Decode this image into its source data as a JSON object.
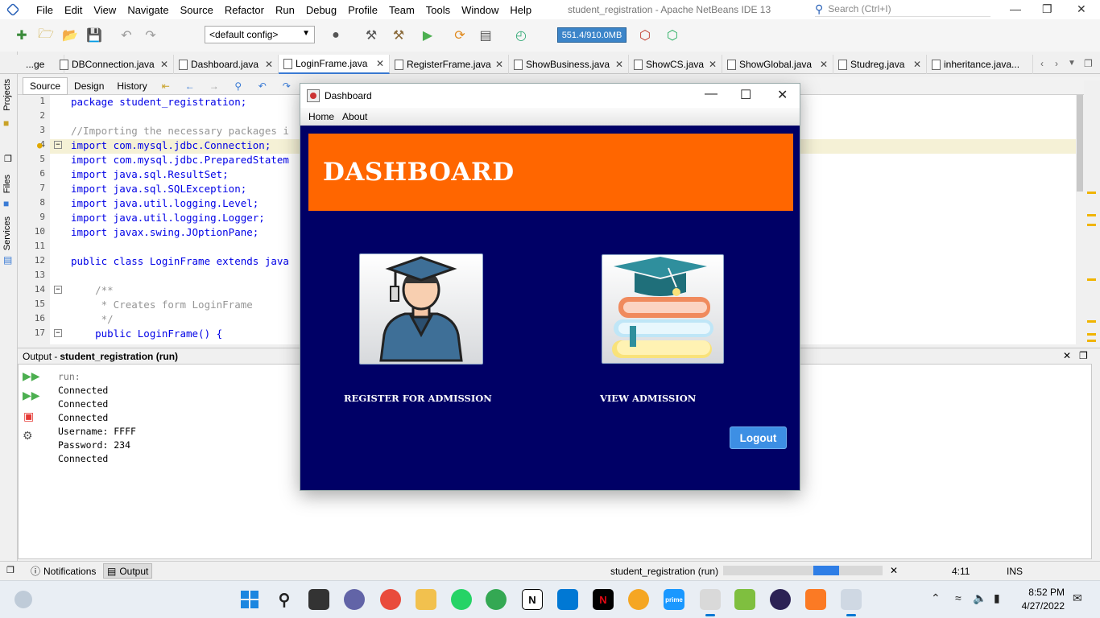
{
  "menubar": {
    "items": [
      "File",
      "Edit",
      "View",
      "Navigate",
      "Source",
      "Refactor",
      "Run",
      "Debug",
      "Profile",
      "Team",
      "Tools",
      "Window",
      "Help"
    ],
    "window_title": "student_registration - Apache NetBeans IDE 13",
    "search_placeholder": "Search (Ctrl+I)"
  },
  "toolbar": {
    "config": "<default config>",
    "memory": "551.4/910.0MB"
  },
  "tabs": [
    {
      "label": "...ge"
    },
    {
      "label": "DBConnection.java"
    },
    {
      "label": "Dashboard.java"
    },
    {
      "label": "LoginFrame.java",
      "active": true
    },
    {
      "label": "RegisterFrame.java"
    },
    {
      "label": "ShowBusiness.java"
    },
    {
      "label": "ShowCS.java"
    },
    {
      "label": "ShowGlobal.java"
    },
    {
      "label": "Studreg.java"
    },
    {
      "label": "inheritance.java..."
    }
  ],
  "sidebar": {
    "projects": "Projects",
    "files": "Files",
    "services": "Services"
  },
  "editor": {
    "views": [
      "Source",
      "Design",
      "History"
    ],
    "lines": [
      {
        "n": "1",
        "text": "package student_registration;"
      },
      {
        "n": "2",
        "text": ""
      },
      {
        "n": "3",
        "text": "//Importing the necessary packages i"
      },
      {
        "n": "4",
        "text": "import com.mysql.jdbc.Connection;"
      },
      {
        "n": "5",
        "text": "import com.mysql.jdbc.PreparedStatem"
      },
      {
        "n": "6",
        "text": "import java.sql.ResultSet;"
      },
      {
        "n": "7",
        "text": "import java.sql.SQLException;"
      },
      {
        "n": "8",
        "text": "import java.util.logging.Level;"
      },
      {
        "n": "9",
        "text": "import java.util.logging.Logger;"
      },
      {
        "n": "10",
        "text": "import javax.swing.JOptionPane;"
      },
      {
        "n": "11",
        "text": ""
      },
      {
        "n": "12",
        "text": "public class LoginFrame extends java"
      },
      {
        "n": "13",
        "text": ""
      },
      {
        "n": "14",
        "text": "    /**"
      },
      {
        "n": "15",
        "text": "     * Creates form LoginFrame"
      },
      {
        "n": "16",
        "text": "     */"
      },
      {
        "n": "17",
        "text": "    public LoginFrame() {"
      }
    ]
  },
  "output": {
    "header_prefix": "Output - ",
    "header_title": "student_registration (run)",
    "lines": [
      "run:",
      "Connected",
      "Connected",
      "Connected",
      "Username: FFFF",
      "Password: 234",
      "Connected"
    ]
  },
  "statusbar": {
    "notifications": "Notifications",
    "output": "Output",
    "task": "student_registration (run)",
    "position": "4:11",
    "mode": "INS"
  },
  "dashboard": {
    "title": "Dashboard",
    "menu": [
      "Home",
      "About"
    ],
    "banner": "DASHBOARD",
    "register_label": "REGISTER FOR ADMISSION",
    "view_label": "VIEW ADMISSION",
    "logout": "Logout",
    "panel_color": "#000066",
    "banner_color": "#ff6600"
  },
  "clock": {
    "time": "8:52 PM",
    "date": "4/27/2022"
  }
}
